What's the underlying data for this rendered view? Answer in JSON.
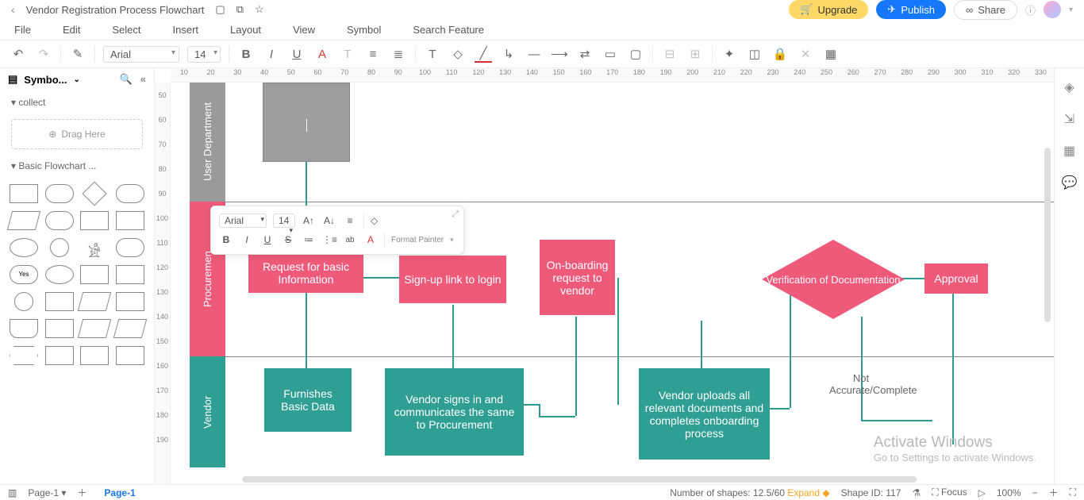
{
  "titlebar": {
    "title": "Vendor Registration Process Flowchart",
    "upgrade": "Upgrade",
    "publish": "Publish",
    "share": "Share"
  },
  "menu": {
    "file": "File",
    "edit": "Edit",
    "select": "Select",
    "insert": "Insert",
    "layout": "Layout",
    "view": "View",
    "symbol": "Symbol",
    "search": "Search Feature"
  },
  "toolbar": {
    "font": "Arial",
    "size": "14"
  },
  "sidebar": {
    "head": "Symbo...",
    "collect": "collect",
    "drag": "Drag Here",
    "basic": "Basic Flowchart ..."
  },
  "mini": {
    "font": "Arial",
    "size": "14",
    "format_painter": "Format Painter"
  },
  "lanes": {
    "ud": "User Department",
    "proc": "Procuremen",
    "vendor": "Vendor"
  },
  "shapes": {
    "req_basic": "Request for basic Information",
    "signup": "Sign-up link to login",
    "onboard_req": "On-boarding request to vendor",
    "verify": "Verification of Documentation",
    "approval": "Approval",
    "furnish": "Furnishes Basic Data",
    "vendor_signin": "Vendor signs in and communicates the same to Procurement",
    "vendor_upload": "Vendor uploads all relevant documents and completes onboarding process",
    "not_accurate": "Not Accurate/Complete"
  },
  "ruler_h": [
    "10",
    "20",
    "30",
    "40",
    "50",
    "60",
    "70",
    "80",
    "90",
    "100",
    "110",
    "120",
    "130",
    "140",
    "150",
    "160",
    "170",
    "180",
    "190",
    "200",
    "210",
    "220",
    "230",
    "240",
    "250",
    "260",
    "270",
    "280",
    "290",
    "300",
    "310",
    "320",
    "330"
  ],
  "ruler_v": [
    "50",
    "60",
    "70",
    "80",
    "90",
    "100",
    "110",
    "120",
    "130",
    "140",
    "150",
    "160",
    "170",
    "180",
    "190"
  ],
  "bottom": {
    "page_sel": "Page-1",
    "page_tab": "Page-1",
    "shape_count": "Number of shapes: 12.5/60",
    "expand": "Expand",
    "shape_id": "Shape ID: 117",
    "focus": "Focus",
    "zoom": "100%"
  },
  "watermark": {
    "title": "Activate Windows",
    "sub": "Go to Settings to activate Windows."
  }
}
